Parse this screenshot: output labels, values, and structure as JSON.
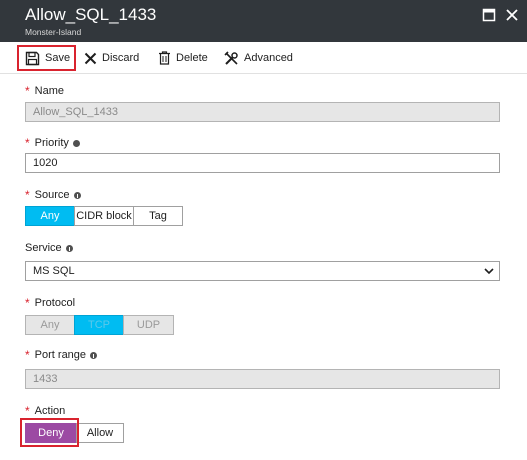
{
  "window": {
    "title": "Allow_SQL_1433",
    "subtitle": "Monster-Island"
  },
  "toolbar": {
    "save_label": "Save",
    "discard_label": "Discard",
    "delete_label": "Delete",
    "advanced_label": "Advanced"
  },
  "form": {
    "name": {
      "label": "Name",
      "value": "Allow_SQL_1433",
      "required": true
    },
    "priority": {
      "label": "Priority",
      "value": "1020",
      "required": true
    },
    "source": {
      "label": "Source",
      "options": [
        "Any",
        "CIDR block",
        "Tag"
      ],
      "selected": "Any",
      "required": true
    },
    "service": {
      "label": "Service",
      "value": "MS SQL"
    },
    "protocol": {
      "label": "Protocol",
      "options": [
        "Any",
        "TCP",
        "UDP"
      ],
      "selected": "TCP",
      "required": true
    },
    "port_range": {
      "label": "Port range",
      "value": "1433",
      "required": true
    },
    "action": {
      "label": "Action",
      "options": [
        "Deny",
        "Allow"
      ],
      "selected": "Deny",
      "required": true
    }
  },
  "colors": {
    "header_bg": "#32373c",
    "selected_blue": "#00bcf2",
    "deny_purple": "#9c4aa3",
    "required_red": "#d9232e",
    "highlight_red": "#d9232e"
  },
  "icons": {
    "save": "save-icon",
    "discard": "close-icon",
    "delete": "trash-icon",
    "advanced": "tools-icon",
    "maximize": "maximize-icon",
    "close_window": "close-icon",
    "info": "info-icon",
    "dropdown": "chevron-down-icon"
  }
}
